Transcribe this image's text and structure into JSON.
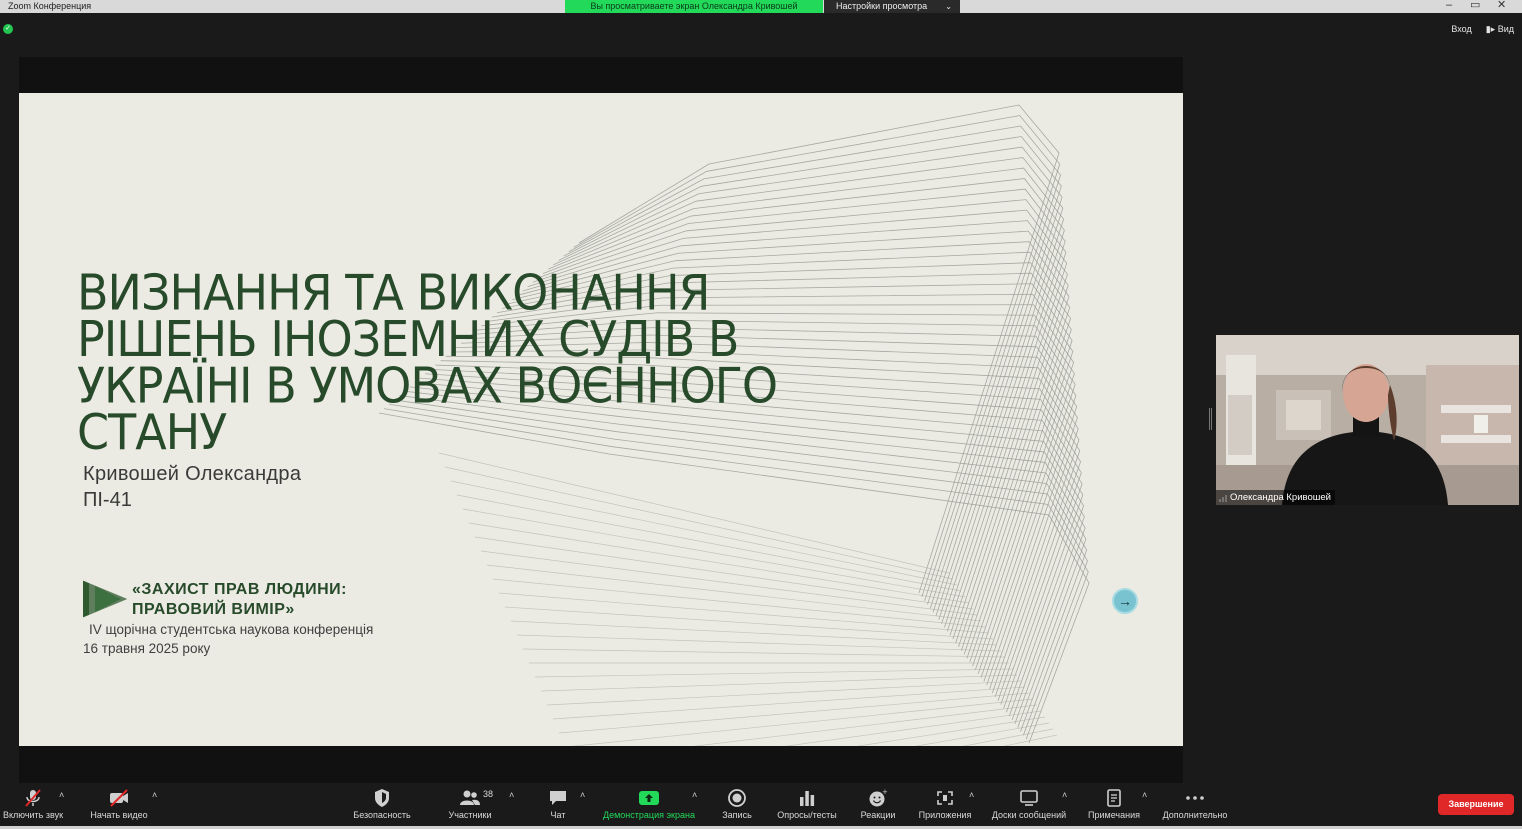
{
  "window": {
    "title": "Zoom Конференция",
    "share_banner": "Вы просматриваете экран Олександра Кривошей",
    "view_settings": "Настройки просмотра",
    "controls": [
      "–",
      "▭",
      "✕"
    ]
  },
  "header": {
    "enter_label": "Вход",
    "view_label": "Вид"
  },
  "slide": {
    "title_lines": [
      "ВИЗНАННЯ ТА ВИКОНАННЯ",
      "РІШЕНЬ ІНОЗЕМНИХ СУДІВ В",
      "УКРАЇНІ В УМОВАХ ВОЄННОГО",
      "СТАНУ"
    ],
    "author": "Кривошей Олександра",
    "group": "ПІ-41",
    "conference_name_line1": "«ЗАХИСТ ПРАВ ЛЮДИНИ:",
    "conference_name_line2": "ПРАВОВИЙ ВИМІР»",
    "conference_subtitle": "IV щорічна студентська наукова конференція",
    "conference_date": "16 травня 2025 року",
    "next_arrow": "→",
    "colors": {
      "title": "#274a2a",
      "background": "#ebebe3"
    }
  },
  "participant": {
    "name": "Олександра Кривошей"
  },
  "toolbar": {
    "items": [
      {
        "label": "Включить звук",
        "icon": "microphone-muted-icon"
      },
      {
        "label": "Начать видео",
        "icon": "video-off-icon"
      },
      {
        "label": "Безопасность",
        "icon": "shield-icon"
      },
      {
        "label": "Участники",
        "icon": "participants-icon",
        "count": "38"
      },
      {
        "label": "Чат",
        "icon": "chat-icon"
      },
      {
        "label": "Демонстрация экрана",
        "icon": "share-screen-icon"
      },
      {
        "label": "Запись",
        "icon": "record-icon"
      },
      {
        "label": "Опросы/тесты",
        "icon": "poll-icon"
      },
      {
        "label": "Реакции",
        "icon": "reactions-icon"
      },
      {
        "label": "Приложения",
        "icon": "apps-icon"
      },
      {
        "label": "Доски сообщений",
        "icon": "whiteboard-icon"
      },
      {
        "label": "Примечания",
        "icon": "notes-icon"
      },
      {
        "label": "Дополнительно",
        "icon": "more-icon"
      }
    ],
    "end_label": "Завершение",
    "share_label_color": "#23d95a",
    "end_color": "#e02828"
  }
}
